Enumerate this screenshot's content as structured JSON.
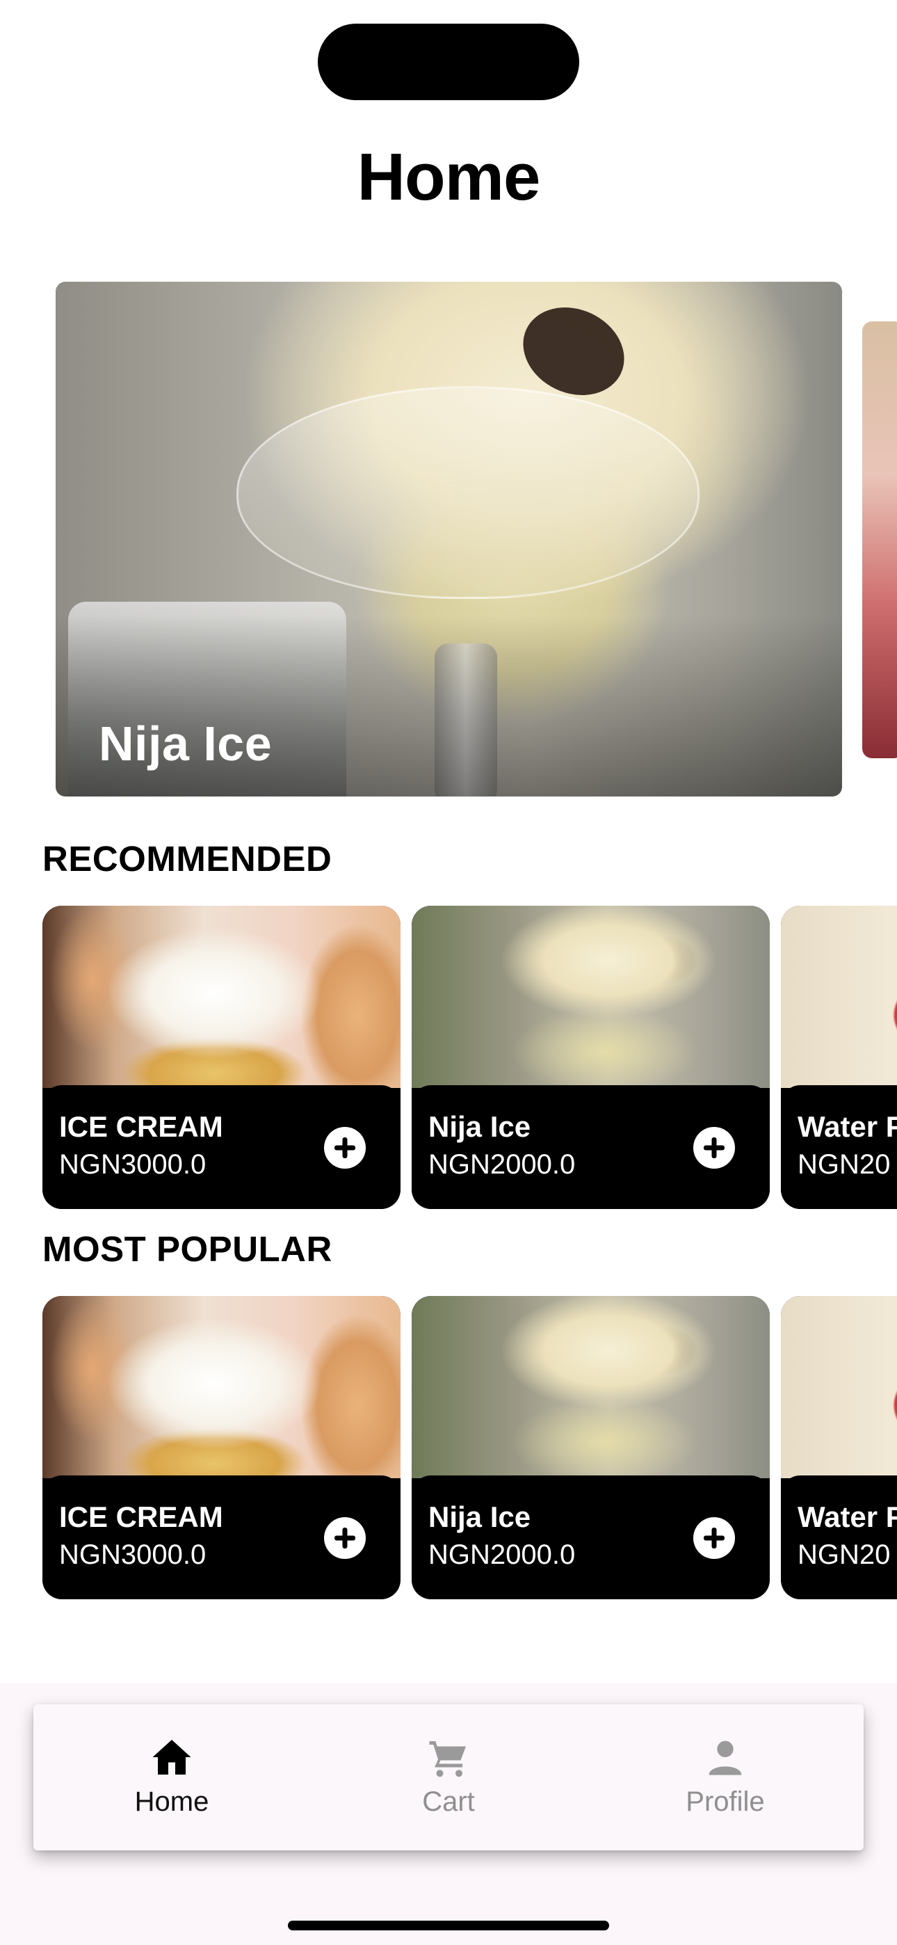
{
  "header": {
    "title": "Home"
  },
  "hero": {
    "slides": [
      {
        "label": "Nija Ice"
      }
    ]
  },
  "recommended": {
    "title": "RECOMMENDED",
    "items": [
      {
        "name": "ICE CREAM",
        "price": "NGN3000.0"
      },
      {
        "name": "Nija Ice",
        "price": "NGN2000.0"
      },
      {
        "name": "Water F",
        "price": "NGN20"
      }
    ]
  },
  "most_popular": {
    "title": "MOST POPULAR",
    "items": [
      {
        "name": "ICE CREAM",
        "price": "NGN3000.0"
      },
      {
        "name": "Nija Ice",
        "price": "NGN2000.0"
      },
      {
        "name": "Water F",
        "price": "NGN20"
      }
    ]
  },
  "bottom_nav": {
    "items": [
      {
        "label": "Home",
        "icon": "home-icon",
        "active": true
      },
      {
        "label": "Cart",
        "icon": "cart-icon",
        "active": false
      },
      {
        "label": "Profile",
        "icon": "person-icon",
        "active": false
      }
    ]
  },
  "colors": {
    "active": "#000000",
    "inactive": "#9a9a9a",
    "card_background": "#000000"
  }
}
